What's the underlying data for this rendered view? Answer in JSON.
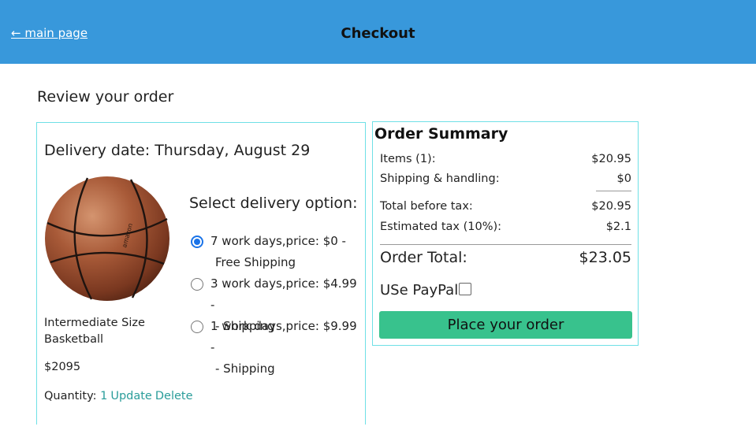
{
  "header": {
    "back_link": "← main page",
    "title": "Checkout",
    "background_color": "#3898db"
  },
  "review_heading": "Review your order",
  "order": {
    "delivery_date": "Delivery date: Thursday, August 29",
    "product_image_icon": "basketball-image",
    "product_name": "Intermediate Size Basketball",
    "price": "$2095",
    "quantity_label": "Quantity:",
    "quantity_value": "1",
    "update_label": "Update",
    "delete_label": "Delete"
  },
  "delivery": {
    "title": "Select delivery option:",
    "options": [
      {
        "line1": "7 work days,price: $0 -",
        "line2": "Free Shipping",
        "selected": true
      },
      {
        "line1": "3 work days,price: $4.99 -",
        "line2": "- Shipping",
        "selected": false
      },
      {
        "line1": "1 work days,price: $9.99 -",
        "line2": "- Shipping",
        "selected": false
      }
    ]
  },
  "summary": {
    "title": "Order Summary",
    "items_label": "Items (1):",
    "items_value": "$20.95",
    "shipping_label": "Shipping & handling:",
    "shipping_value": "$0",
    "before_tax_label": "Total before tax:",
    "before_tax_value": "$20.95",
    "tax_label": "Estimated tax (10%):",
    "tax_value": "$2.1",
    "total_label": "Order Total:",
    "total_value": "$23.05",
    "paypal_label": "USe PayPal",
    "paypal_checked": false,
    "place_order_label": "Place your order",
    "accent_color": "#38c28d",
    "border_color": "#6fe0e6"
  }
}
